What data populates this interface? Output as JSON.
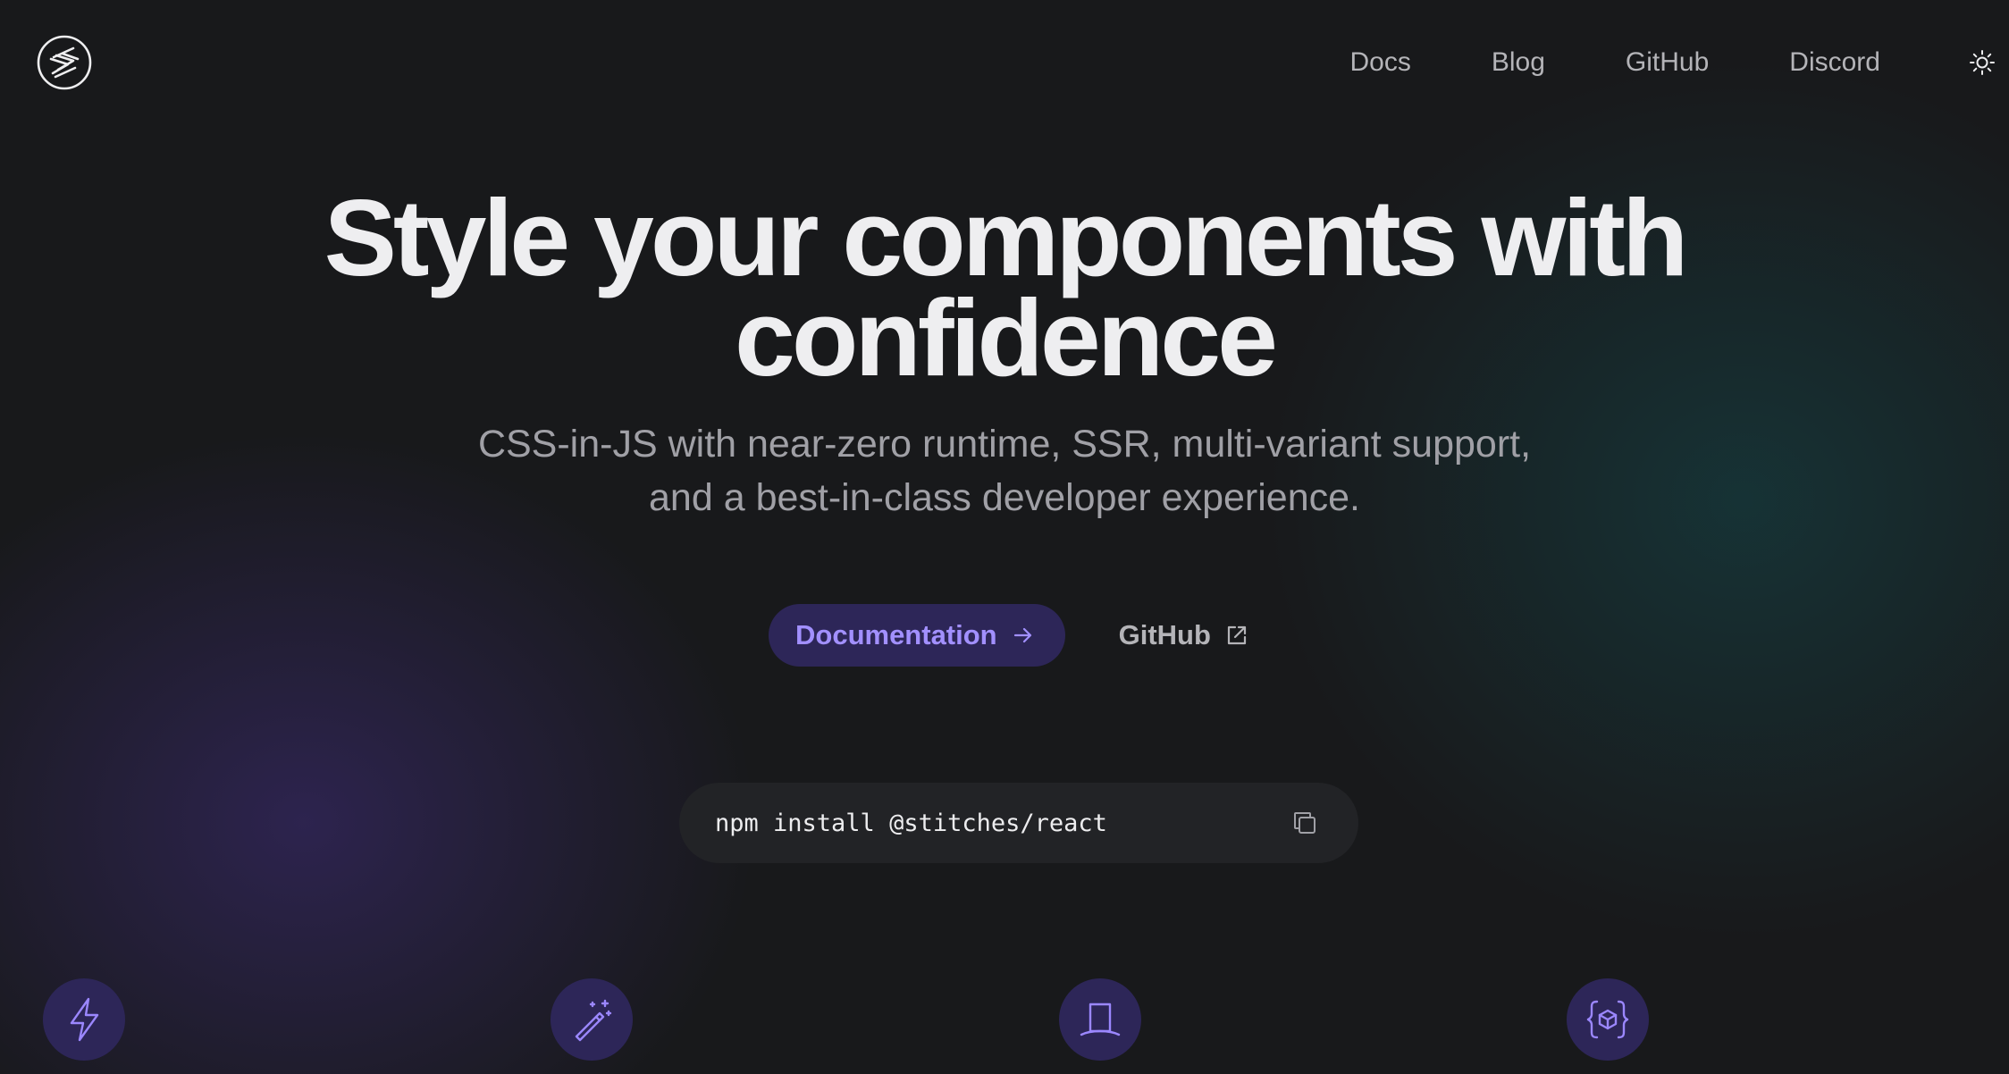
{
  "header": {
    "logo_icon": "stitches-logo-icon",
    "nav": [
      {
        "label": "Docs"
      },
      {
        "label": "Blog"
      },
      {
        "label": "GitHub"
      },
      {
        "label": "Discord"
      }
    ],
    "theme_toggle_icon": "sun-icon"
  },
  "hero": {
    "title_line1": "Style your components with",
    "title_line2": "confidence",
    "subtitle_line1": "CSS-in-JS with near-zero runtime, SSR, multi-variant support,",
    "subtitle_line2": "and a best-in-class developer experience."
  },
  "cta": {
    "primary_label": "Documentation",
    "primary_icon": "arrow-right-icon",
    "secondary_label": "GitHub",
    "secondary_icon": "external-link-icon"
  },
  "install": {
    "command": "npm install @stitches/react",
    "copy_icon": "copy-icon"
  },
  "features": [
    {
      "icon": "lightning-bolt-icon"
    },
    {
      "icon": "magic-wand-icon"
    },
    {
      "icon": "top-hat-icon"
    },
    {
      "icon": "code-sandbox-icon"
    }
  ],
  "colors": {
    "background": "#18191b",
    "accent": "#a290ff",
    "accent_bg": "#2d2658",
    "text_primary": "#eeeef0",
    "text_secondary": "#a0a0a6",
    "nav_text": "#b4b4b8",
    "install_bg": "#222326"
  }
}
